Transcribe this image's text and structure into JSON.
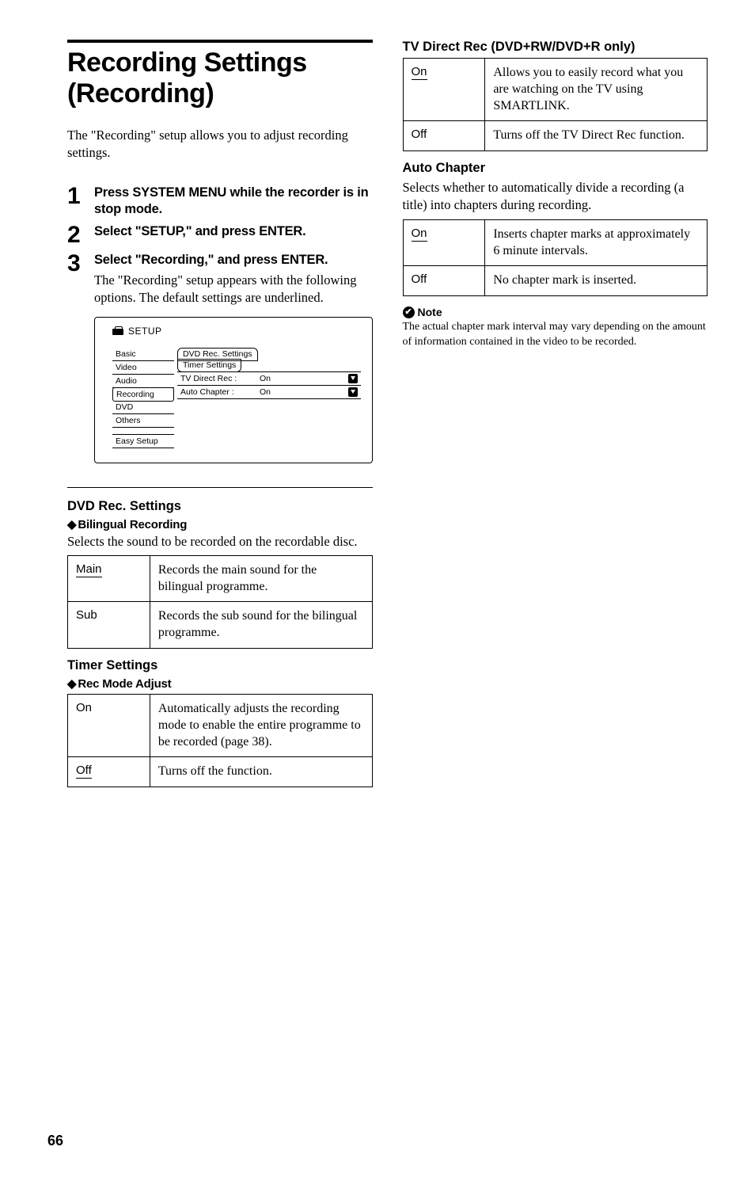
{
  "left": {
    "main_title": "Recording Settings (Recording)",
    "intro": "The \"Recording\" setup allows you to adjust recording settings.",
    "steps": [
      {
        "num": "1",
        "title": "Press SYSTEM MENU while the recorder is in stop mode.",
        "desc": ""
      },
      {
        "num": "2",
        "title": "Select \"SETUP,\" and press ENTER.",
        "desc": ""
      },
      {
        "num": "3",
        "title": "Select \"Recording,\" and press ENTER.",
        "desc": "The \"Recording\" setup appears with the following options. The default settings are underlined."
      }
    ],
    "setup_screen": {
      "label": "SETUP",
      "left_menu": [
        "Basic",
        "Video",
        "Audio",
        "Recording",
        "DVD",
        "Others"
      ],
      "left_selected": "Recording",
      "left_bottom": "Easy Setup",
      "tabs": [
        "DVD Rec. Settings",
        "Timer Settings"
      ],
      "fields": [
        {
          "name": "TV Direct Rec :",
          "val": "On"
        },
        {
          "name": "Auto Chapter :",
          "val": "On"
        }
      ]
    },
    "dvd_rec_heading": "DVD Rec. Settings",
    "bilingual": {
      "heading": "Bilingual Recording",
      "desc": "Selects the sound to be recorded on the recordable disc.",
      "rows": [
        {
          "opt": "Main",
          "default": true,
          "desc": "Records the main sound for the bilingual programme."
        },
        {
          "opt": "Sub",
          "default": false,
          "desc": "Records the sub sound for the bilingual programme."
        }
      ]
    },
    "timer_heading": "Timer Settings",
    "rec_mode": {
      "heading": "Rec Mode Adjust",
      "rows": [
        {
          "opt": "On",
          "default": false,
          "desc": "Automatically adjusts the recording mode to enable the entire programme to be recorded (page 38)."
        },
        {
          "opt": "Off",
          "default": true,
          "desc": "Turns off the function."
        }
      ]
    }
  },
  "right": {
    "tv_direct": {
      "heading": "TV Direct Rec (DVD+RW/DVD+R only)",
      "rows": [
        {
          "opt": "On",
          "default": true,
          "desc": "Allows you to easily record what you are watching on the TV using SMARTLINK."
        },
        {
          "opt": "Off",
          "default": false,
          "desc": "Turns off the TV Direct Rec function."
        }
      ]
    },
    "auto_chapter": {
      "heading": "Auto Chapter",
      "desc": "Selects whether to automatically divide a recording (a title) into chapters during recording.",
      "rows": [
        {
          "opt": "On",
          "default": true,
          "desc": "Inserts chapter marks at approximately 6 minute intervals."
        },
        {
          "opt": "Off",
          "default": false,
          "desc": "No chapter mark is inserted."
        }
      ]
    },
    "note": {
      "heading": "Note",
      "body": "The actual chapter mark interval may vary depending on the amount of information contained in the video to be recorded."
    }
  },
  "page_number": "66"
}
